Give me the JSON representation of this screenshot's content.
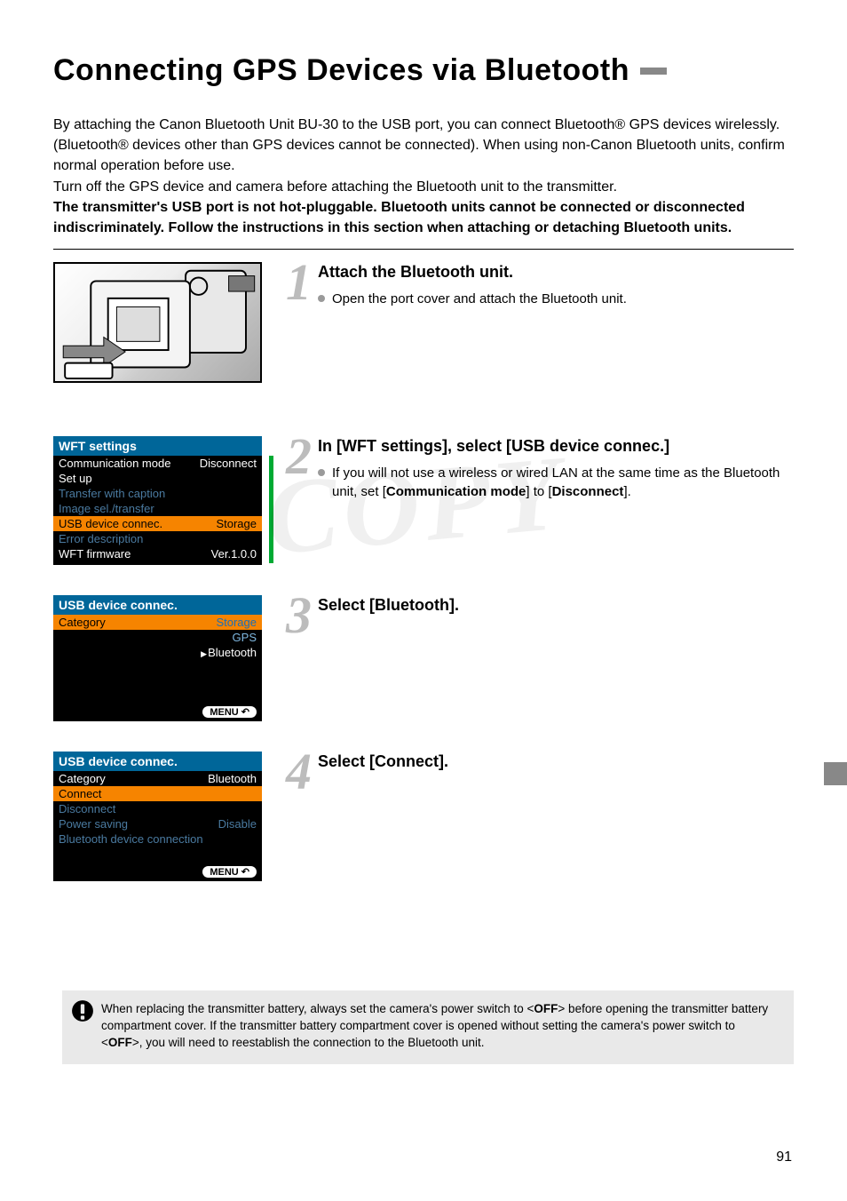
{
  "title": "Connecting GPS Devices via Bluetooth",
  "intro": {
    "p1": "By attaching the Canon Bluetooth Unit BU-30 to the USB port, you can connect Bluetooth® GPS devices wirelessly. (Bluetooth® devices other than GPS devices cannot be connected). When using non-Canon Bluetooth units, confirm normal operation before use.",
    "p2": "Turn off the GPS device and camera before attaching the Bluetooth unit to the transmitter.",
    "p3": "The transmitter's USB port is not hot-pluggable. Bluetooth units cannot be connected or disconnected indiscriminately. Follow the instructions in this section when attaching or detaching Bluetooth units."
  },
  "steps": {
    "s1": {
      "num": "1",
      "title": "Attach the Bluetooth unit.",
      "b1": "Open the port cover and attach the Bluetooth unit."
    },
    "s2": {
      "num": "2",
      "title": "In [WFT settings], select [USB device connec.]",
      "b1_pre": "If you will not use a wireless or wired LAN at the same time as the Bluetooth unit, set [",
      "b1_bold1": "Communication mode",
      "b1_mid": "] to [",
      "b1_bold2": "Disconnect",
      "b1_post": "]."
    },
    "s3": {
      "num": "3",
      "title": "Select [Bluetooth]."
    },
    "s4": {
      "num": "4",
      "title": "Select [Connect]."
    }
  },
  "lcd1": {
    "hdr": "WFT settings",
    "r1l": "Communication mode",
    "r1r": "Disconnect",
    "r2l": "Set up",
    "r3l": "Transfer with caption",
    "r4l": "Image sel./transfer",
    "r5l": "USB device connec.",
    "r5r": "Storage",
    "r6l": "Error description",
    "r7l": "WFT firmware",
    "r7r": "Ver.1.0.0"
  },
  "lcd2": {
    "hdr": "USB device connec.",
    "catlbl": "Category",
    "o1": "Storage",
    "o2": "GPS",
    "o3": "Bluetooth",
    "menu": "MENU"
  },
  "lcd3": {
    "hdr": "USB device connec.",
    "r1l": "Category",
    "r1r": "Bluetooth",
    "r2l": "Connect",
    "r3l": "Disconnect",
    "r4l": "Power saving",
    "r4r": "Disable",
    "r5l": "Bluetooth device connection",
    "menu": "MENU"
  },
  "caution": {
    "pre": "When replacing the transmitter battery, always set the camera's power switch to <",
    "off1": "OFF",
    "mid1": "> before opening the transmitter battery compartment cover. If the transmitter battery compartment cover is opened without setting the camera's power switch to <",
    "off2": "OFF",
    "post": ">, you will need to reestablish the connection to the Bluetooth unit."
  },
  "watermark": "COPY",
  "page_num": "91"
}
